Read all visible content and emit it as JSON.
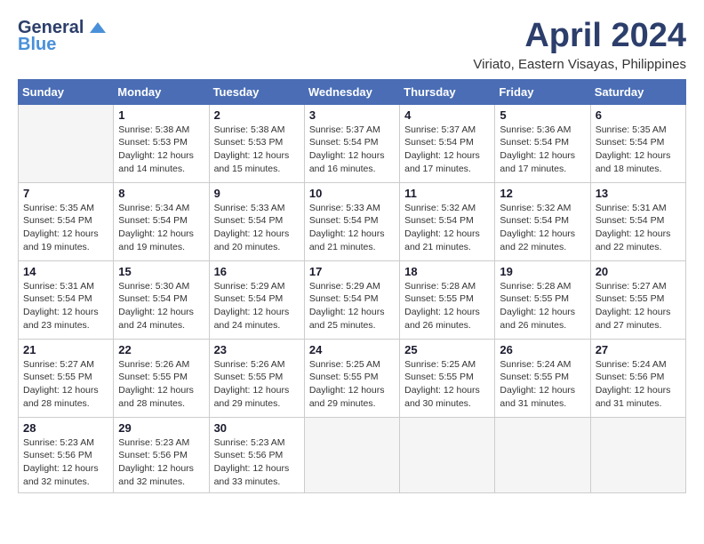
{
  "header": {
    "logo": {
      "general": "General",
      "blue": "Blue"
    },
    "title": "April 2024",
    "subtitle": "Viriato, Eastern Visayas, Philippines"
  },
  "weekdays": [
    "Sunday",
    "Monday",
    "Tuesday",
    "Wednesday",
    "Thursday",
    "Friday",
    "Saturday"
  ],
  "weeks": [
    [
      {
        "day": "",
        "empty": true
      },
      {
        "day": "1",
        "sunrise": "5:38 AM",
        "sunset": "5:53 PM",
        "daylight": "12 hours and 14 minutes."
      },
      {
        "day": "2",
        "sunrise": "5:38 AM",
        "sunset": "5:53 PM",
        "daylight": "12 hours and 15 minutes."
      },
      {
        "day": "3",
        "sunrise": "5:37 AM",
        "sunset": "5:54 PM",
        "daylight": "12 hours and 16 minutes."
      },
      {
        "day": "4",
        "sunrise": "5:37 AM",
        "sunset": "5:54 PM",
        "daylight": "12 hours and 17 minutes."
      },
      {
        "day": "5",
        "sunrise": "5:36 AM",
        "sunset": "5:54 PM",
        "daylight": "12 hours and 17 minutes."
      },
      {
        "day": "6",
        "sunrise": "5:35 AM",
        "sunset": "5:54 PM",
        "daylight": "12 hours and 18 minutes."
      }
    ],
    [
      {
        "day": "7",
        "sunrise": "5:35 AM",
        "sunset": "5:54 PM",
        "daylight": "12 hours and 19 minutes."
      },
      {
        "day": "8",
        "sunrise": "5:34 AM",
        "sunset": "5:54 PM",
        "daylight": "12 hours and 19 minutes."
      },
      {
        "day": "9",
        "sunrise": "5:33 AM",
        "sunset": "5:54 PM",
        "daylight": "12 hours and 20 minutes."
      },
      {
        "day": "10",
        "sunrise": "5:33 AM",
        "sunset": "5:54 PM",
        "daylight": "12 hours and 21 minutes."
      },
      {
        "day": "11",
        "sunrise": "5:32 AM",
        "sunset": "5:54 PM",
        "daylight": "12 hours and 21 minutes."
      },
      {
        "day": "12",
        "sunrise": "5:32 AM",
        "sunset": "5:54 PM",
        "daylight": "12 hours and 22 minutes."
      },
      {
        "day": "13",
        "sunrise": "5:31 AM",
        "sunset": "5:54 PM",
        "daylight": "12 hours and 22 minutes."
      }
    ],
    [
      {
        "day": "14",
        "sunrise": "5:31 AM",
        "sunset": "5:54 PM",
        "daylight": "12 hours and 23 minutes."
      },
      {
        "day": "15",
        "sunrise": "5:30 AM",
        "sunset": "5:54 PM",
        "daylight": "12 hours and 24 minutes."
      },
      {
        "day": "16",
        "sunrise": "5:29 AM",
        "sunset": "5:54 PM",
        "daylight": "12 hours and 24 minutes."
      },
      {
        "day": "17",
        "sunrise": "5:29 AM",
        "sunset": "5:54 PM",
        "daylight": "12 hours and 25 minutes."
      },
      {
        "day": "18",
        "sunrise": "5:28 AM",
        "sunset": "5:55 PM",
        "daylight": "12 hours and 26 minutes."
      },
      {
        "day": "19",
        "sunrise": "5:28 AM",
        "sunset": "5:55 PM",
        "daylight": "12 hours and 26 minutes."
      },
      {
        "day": "20",
        "sunrise": "5:27 AM",
        "sunset": "5:55 PM",
        "daylight": "12 hours and 27 minutes."
      }
    ],
    [
      {
        "day": "21",
        "sunrise": "5:27 AM",
        "sunset": "5:55 PM",
        "daylight": "12 hours and 28 minutes."
      },
      {
        "day": "22",
        "sunrise": "5:26 AM",
        "sunset": "5:55 PM",
        "daylight": "12 hours and 28 minutes."
      },
      {
        "day": "23",
        "sunrise": "5:26 AM",
        "sunset": "5:55 PM",
        "daylight": "12 hours and 29 minutes."
      },
      {
        "day": "24",
        "sunrise": "5:25 AM",
        "sunset": "5:55 PM",
        "daylight": "12 hours and 29 minutes."
      },
      {
        "day": "25",
        "sunrise": "5:25 AM",
        "sunset": "5:55 PM",
        "daylight": "12 hours and 30 minutes."
      },
      {
        "day": "26",
        "sunrise": "5:24 AM",
        "sunset": "5:55 PM",
        "daylight": "12 hours and 31 minutes."
      },
      {
        "day": "27",
        "sunrise": "5:24 AM",
        "sunset": "5:56 PM",
        "daylight": "12 hours and 31 minutes."
      }
    ],
    [
      {
        "day": "28",
        "sunrise": "5:23 AM",
        "sunset": "5:56 PM",
        "daylight": "12 hours and 32 minutes."
      },
      {
        "day": "29",
        "sunrise": "5:23 AM",
        "sunset": "5:56 PM",
        "daylight": "12 hours and 32 minutes."
      },
      {
        "day": "30",
        "sunrise": "5:23 AM",
        "sunset": "5:56 PM",
        "daylight": "12 hours and 33 minutes."
      },
      {
        "day": "",
        "empty": true
      },
      {
        "day": "",
        "empty": true
      },
      {
        "day": "",
        "empty": true
      },
      {
        "day": "",
        "empty": true
      }
    ]
  ]
}
